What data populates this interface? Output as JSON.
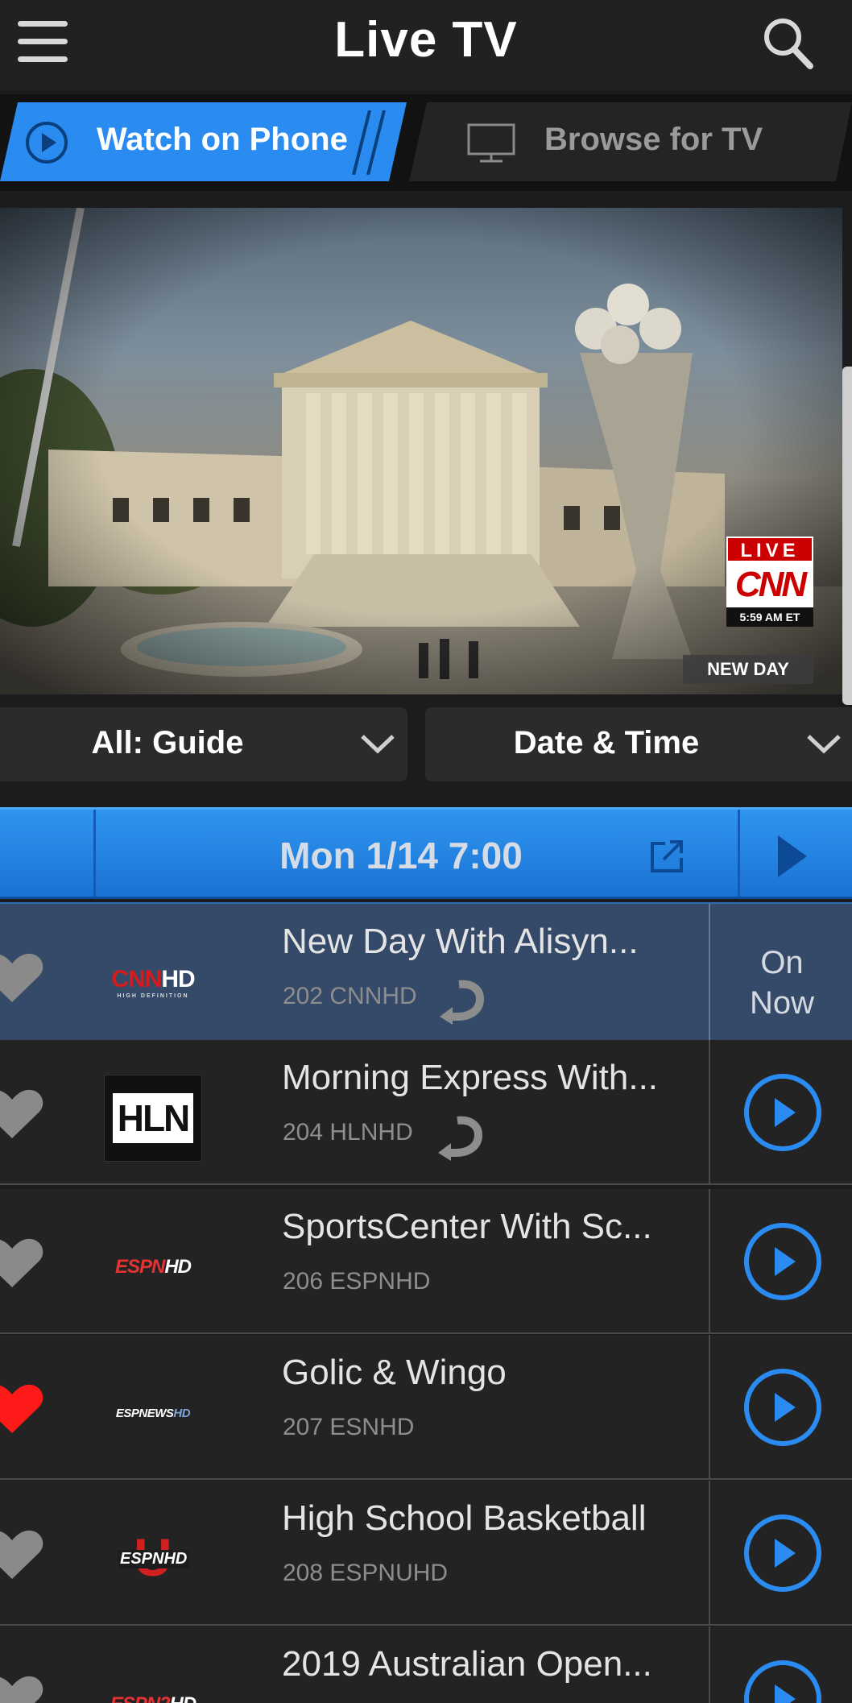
{
  "header": {
    "title": "Live TV"
  },
  "mode_tabs": {
    "phone_label": "Watch on Phone",
    "tv_label": "Browse for TV",
    "active": "phone"
  },
  "player": {
    "live_label": "LIVE",
    "network": "CNN",
    "time": "5:59 AM ET",
    "show_badge": "NEW DAY"
  },
  "filters": {
    "guide": "All: Guide",
    "datetime": "Date & Time"
  },
  "time_bar": {
    "label": "Mon 1/14 7:00"
  },
  "colors": {
    "accent": "#2a8cf0",
    "favorite_active": "#ff1a1a",
    "favorite_inactive": "#8a8a8a",
    "current_row": "#344a68"
  },
  "channels": [
    {
      "title": "New Day With Alisyn...",
      "channel": "202 CNNHD",
      "logo": "CNN HD",
      "logo_sub": "HIGH DEFINITION",
      "favorite": false,
      "restart": true,
      "status": "On Now"
    },
    {
      "title": "Morning Express With...",
      "channel": "204 HLNHD",
      "logo": "HLN",
      "favorite": false,
      "restart": true
    },
    {
      "title": "SportsCenter With Sc...",
      "channel": "206 ESPNHD",
      "logo": "ESPN HD",
      "favorite": false,
      "restart": false
    },
    {
      "title": "Golic & Wingo",
      "channel": "207 ESNHD",
      "logo": "ESPNEWS HD",
      "favorite": true,
      "restart": false
    },
    {
      "title": "High School Basketball",
      "channel": "208 ESPNUHD",
      "logo": "ESPN HD U",
      "favorite": false,
      "restart": false
    },
    {
      "title": "2019 Australian Open...",
      "channel": "",
      "logo": "ESPN2 HD",
      "favorite": false,
      "restart": false
    }
  ]
}
